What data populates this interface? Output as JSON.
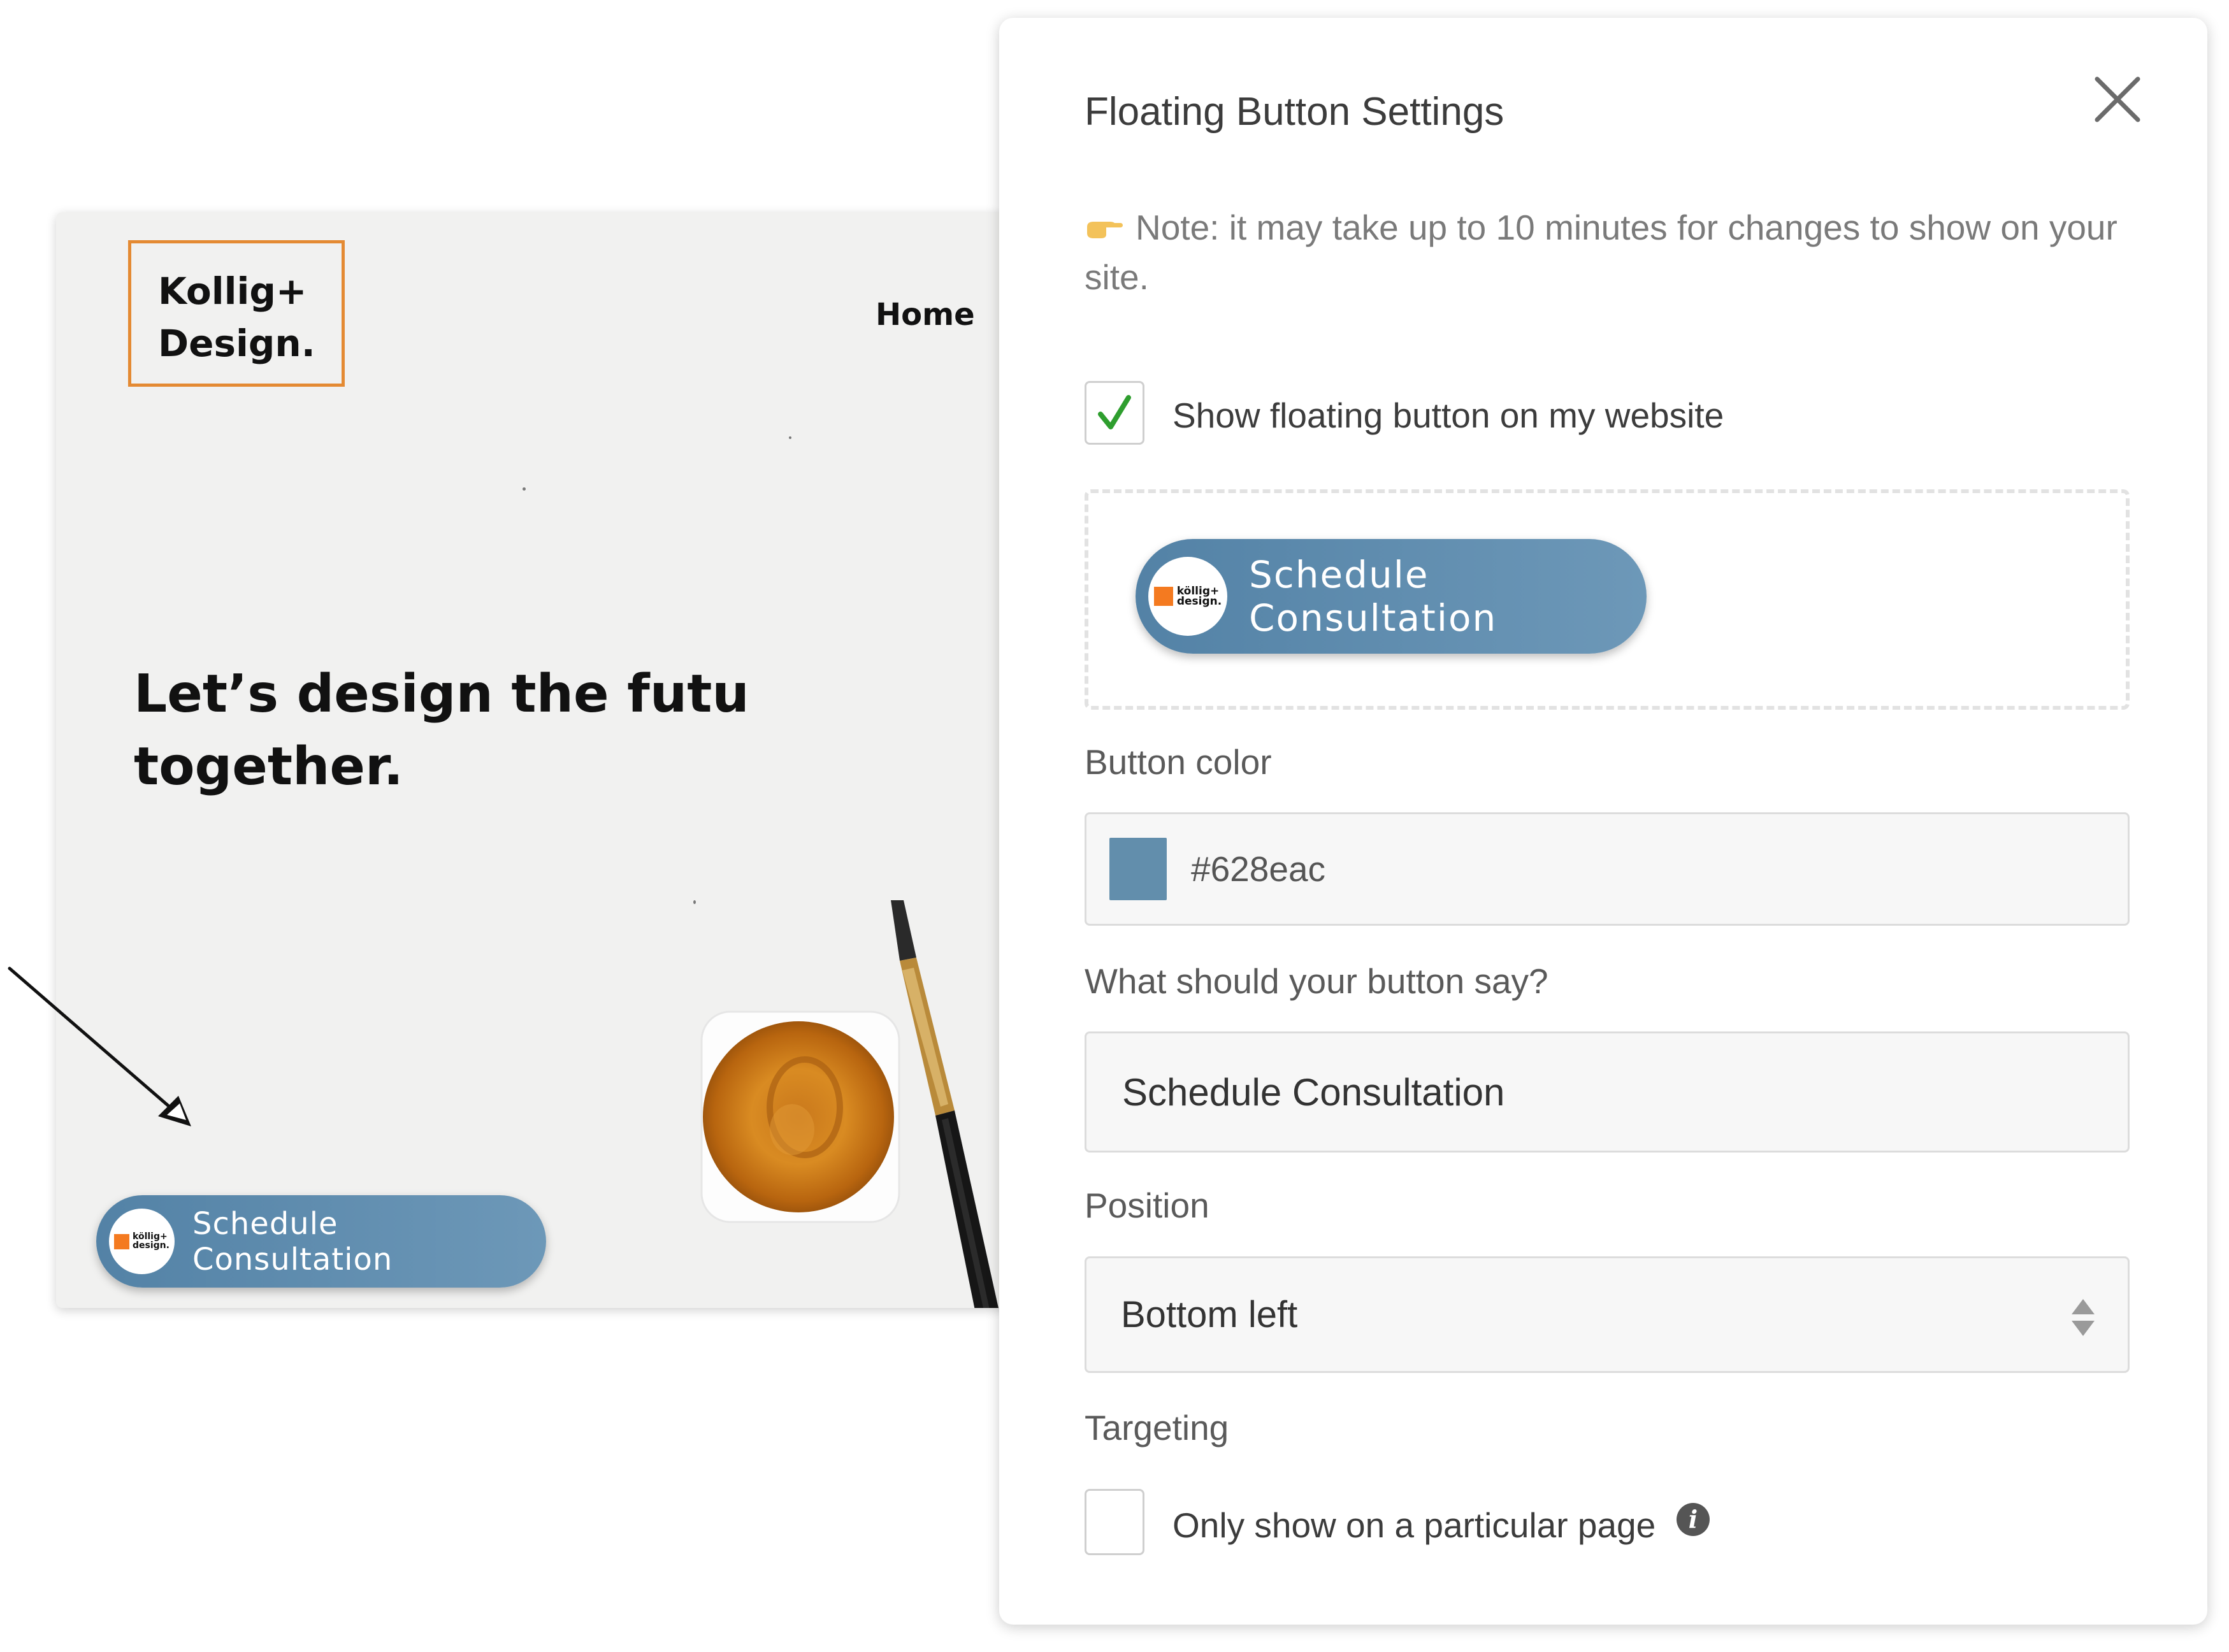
{
  "site": {
    "logo_text": "Kollig+\nDesign.",
    "nav_home": "Home",
    "hero_text": "Let’s design the futu\ntogether.",
    "floating_button": {
      "badge_text": "köllig+\ndesign.",
      "label": "Schedule Consultation"
    }
  },
  "panel": {
    "title": "Floating Button Settings",
    "note": "Note: it may take up to 10 minutes for changes to show on your site.",
    "show_button": {
      "label": "Show floating button on my website",
      "checked": true
    },
    "preview": {
      "badge_text": "köllig+\ndesign.",
      "label": "Schedule Consultation"
    },
    "button_color": {
      "label": "Button color",
      "value": "#628eac"
    },
    "button_text": {
      "label": "What should your button say?",
      "value": "Schedule Consultation"
    },
    "position": {
      "label": "Position",
      "value": "Bottom left"
    },
    "targeting": {
      "label": "Targeting",
      "option_label": "Only show on a particular page",
      "checked": false
    }
  },
  "colors": {
    "button": "#628eac",
    "logo_border": "#e48a33",
    "badge_square": "#f47a20",
    "check_mark": "#2e9e2e"
  },
  "icons": [
    "close-icon",
    "pointing-hand-icon",
    "check-icon",
    "info-icon",
    "select-arrows-icon",
    "arrow-pointer"
  ]
}
